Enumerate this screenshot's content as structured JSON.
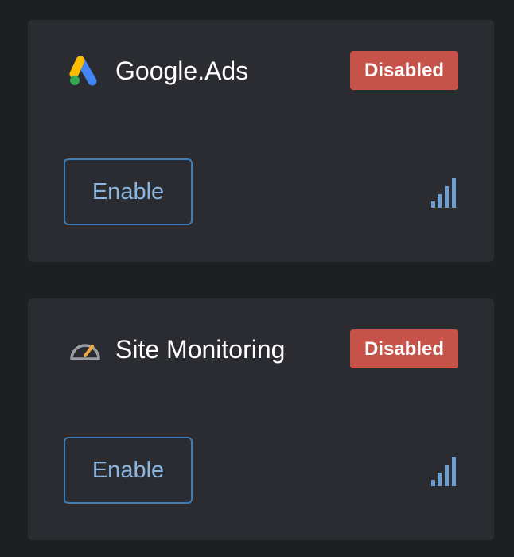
{
  "cards": [
    {
      "title": "Google.Ads",
      "status": "Disabled",
      "button_label": "Enable",
      "icon": "google-ads-icon",
      "signal_icon": "signal-strength-icon"
    },
    {
      "title": "Site Monitoring",
      "status": "Disabled",
      "button_label": "Enable",
      "icon": "speedometer-icon",
      "signal_icon": "signal-strength-icon"
    }
  ],
  "colors": {
    "background": "#1e1f21",
    "card": "#2a2c31",
    "status_disabled": "#c6524a",
    "button_border": "#3e7eb8",
    "button_text": "#8ab6e0",
    "signal": "#6f9fd0"
  }
}
